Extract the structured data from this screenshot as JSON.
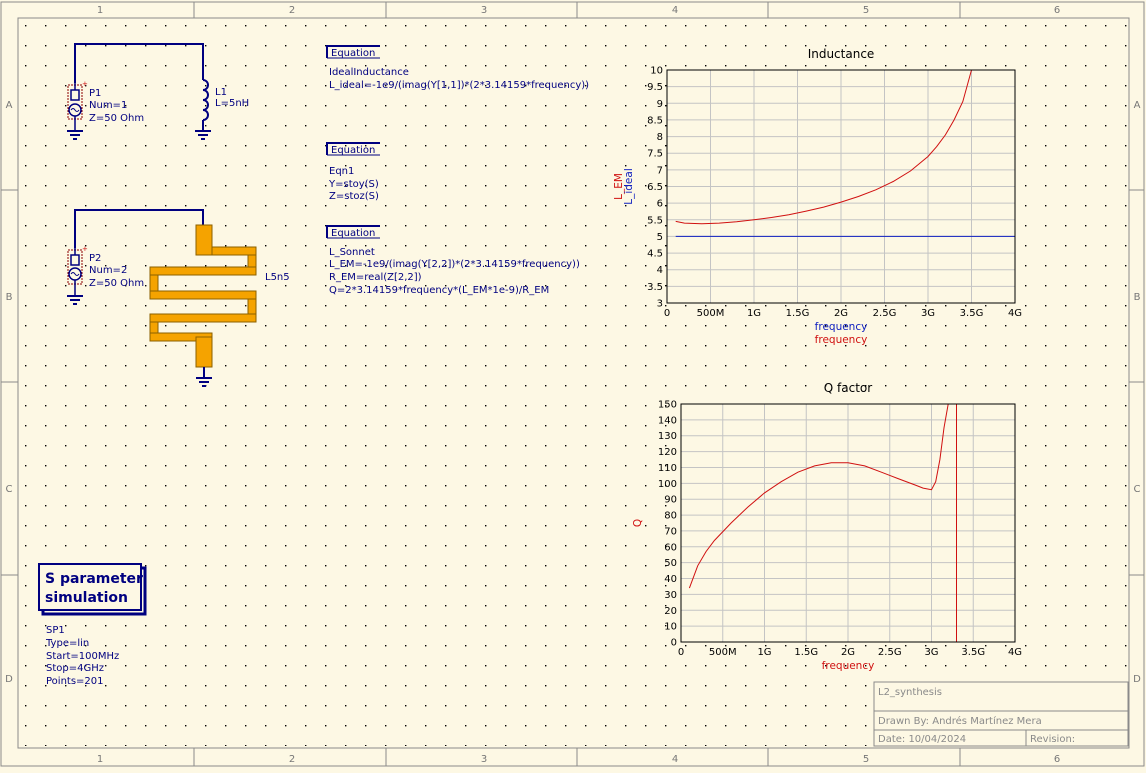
{
  "frame": {
    "cols": [
      "1",
      "2",
      "3",
      "4",
      "5",
      "6"
    ],
    "rows": [
      "A",
      "B",
      "C",
      "D"
    ]
  },
  "components": {
    "p1": {
      "name": "P1",
      "num": "Num=1",
      "z": "Z=50 Ohm"
    },
    "l1": {
      "name": "L1",
      "value": "L=5nH"
    },
    "p2": {
      "name": "P2",
      "num": "Num=2",
      "z": "Z=50 Ohm"
    },
    "em": {
      "name": "L5n5"
    }
  },
  "equations": [
    {
      "header": "Equation",
      "lines": [
        "IdealInductance",
        "L_ideal=-1e9/(imag(Y[1,1])*(2*3.14159*frequency))"
      ]
    },
    {
      "header": "Equation",
      "lines": [
        "Eqn1",
        "Y=stoy(S)",
        "Z=stoz(S)"
      ]
    },
    {
      "header": "Equation",
      "lines": [
        "L_Sonnet",
        "L_EM=-1e9/(imag(Y[2,2])*(2*3.14159*frequency))",
        "R_EM=real(Z[2,2])",
        "Q=2*3.14159*frequency*(L_EM*1e-9)/R_EM"
      ]
    }
  ],
  "simulation": {
    "title_line1": "S parameter",
    "title_line2": "simulation",
    "params": [
      "SP1",
      "Type=lin",
      "Start=100MHz",
      "Stop=4GHz",
      "Points=201"
    ]
  },
  "titleblock": {
    "name": "L2_synthesis",
    "drawn_by": "Drawn By: Andrés Martínez Mera",
    "date": "Date: 10/04/2024",
    "revision": "Revision:"
  },
  "chart_data": [
    {
      "type": "line",
      "title": "Inductance",
      "ylabels": [
        {
          "text": "L_EM",
          "color": "#d01010"
        },
        {
          "text": "L_ideal",
          "color": "#1020c0"
        }
      ],
      "xlabels": [
        {
          "text": "frequency",
          "color": "#1020c0"
        },
        {
          "text": "frequency",
          "color": "#d01010"
        }
      ],
      "xlim": [
        0,
        4
      ],
      "ylim": [
        3,
        10
      ],
      "xticks": [
        {
          "v": 0,
          "t": "0"
        },
        {
          "v": 0.5,
          "t": "500M"
        },
        {
          "v": 1,
          "t": "1G"
        },
        {
          "v": 1.5,
          "t": "1.5G"
        },
        {
          "v": 2,
          "t": "2G"
        },
        {
          "v": 2.5,
          "t": "2.5G"
        },
        {
          "v": 3,
          "t": "3G"
        },
        {
          "v": 3.5,
          "t": "3.5G"
        },
        {
          "v": 4,
          "t": "4G"
        }
      ],
      "yticks": [
        {
          "v": 3,
          "t": "3"
        },
        {
          "v": 3.5,
          "t": "3.5"
        },
        {
          "v": 4,
          "t": "4"
        },
        {
          "v": 4.5,
          "t": "4.5"
        },
        {
          "v": 5,
          "t": "5"
        },
        {
          "v": 5.5,
          "t": "5.5"
        },
        {
          "v": 6,
          "t": "6"
        },
        {
          "v": 6.5,
          "t": "6.5"
        },
        {
          "v": 7,
          "t": "7"
        },
        {
          "v": 7.5,
          "t": "7.5"
        },
        {
          "v": 8,
          "t": "8"
        },
        {
          "v": 8.5,
          "t": "8.5"
        },
        {
          "v": 9,
          "t": "9"
        },
        {
          "v": 9.5,
          "t": "9.5"
        },
        {
          "v": 10,
          "t": "10"
        }
      ],
      "grid": true,
      "series": [
        {
          "name": "L_EM",
          "color": "#d01010",
          "x": [
            0.1,
            0.2,
            0.4,
            0.6,
            0.8,
            1.0,
            1.2,
            1.4,
            1.6,
            1.8,
            2.0,
            2.2,
            2.4,
            2.6,
            2.8,
            3.0,
            3.1,
            3.2,
            3.3,
            3.4,
            3.5
          ],
          "y": [
            5.45,
            5.4,
            5.38,
            5.4,
            5.44,
            5.5,
            5.57,
            5.65,
            5.76,
            5.88,
            6.03,
            6.2,
            6.4,
            6.65,
            6.97,
            7.4,
            7.7,
            8.05,
            8.5,
            9.05,
            10.0
          ]
        },
        {
          "name": "L_ideal",
          "color": "#1020c0",
          "x": [
            0.1,
            4.0
          ],
          "y": [
            5.0,
            5.0
          ]
        }
      ]
    },
    {
      "type": "line",
      "title": "Q factor",
      "ylabels": [
        {
          "text": "Q",
          "color": "#d01010"
        }
      ],
      "xlabels": [
        {
          "text": "frequency",
          "color": "#d01010"
        }
      ],
      "xlim": [
        0,
        4
      ],
      "ylim": [
        0,
        150
      ],
      "xticks": [
        {
          "v": 0,
          "t": "0"
        },
        {
          "v": 0.5,
          "t": "500M"
        },
        {
          "v": 1,
          "t": "1G"
        },
        {
          "v": 1.5,
          "t": "1.5G"
        },
        {
          "v": 2,
          "t": "2G"
        },
        {
          "v": 2.5,
          "t": "2.5G"
        },
        {
          "v": 3,
          "t": "3G"
        },
        {
          "v": 3.5,
          "t": "3.5G"
        },
        {
          "v": 4,
          "t": "4G"
        }
      ],
      "yticks": [
        {
          "v": 0,
          "t": "0"
        },
        {
          "v": 10,
          "t": "10"
        },
        {
          "v": 20,
          "t": "20"
        },
        {
          "v": 30,
          "t": "30"
        },
        {
          "v": 40,
          "t": "40"
        },
        {
          "v": 50,
          "t": "50"
        },
        {
          "v": 60,
          "t": "60"
        },
        {
          "v": 70,
          "t": "70"
        },
        {
          "v": 80,
          "t": "80"
        },
        {
          "v": 90,
          "t": "90"
        },
        {
          "v": 100,
          "t": "100"
        },
        {
          "v": 110,
          "t": "110"
        },
        {
          "v": 120,
          "t": "120"
        },
        {
          "v": 130,
          "t": "130"
        },
        {
          "v": 140,
          "t": "140"
        },
        {
          "v": 150,
          "t": "150"
        }
      ],
      "grid": true,
      "series": [
        {
          "name": "Q",
          "color": "#d01010",
          "x": [
            0.1,
            0.2,
            0.3,
            0.4,
            0.6,
            0.8,
            1.0,
            1.2,
            1.4,
            1.6,
            1.8,
            2.0,
            2.2,
            2.4,
            2.6,
            2.8,
            2.9,
            3.0,
            3.05,
            3.1,
            3.15,
            3.2,
            3.3,
            3.3,
            3.35,
            4.0
          ],
          "y": [
            34,
            48,
            57,
            64,
            75,
            85,
            94,
            101,
            107,
            111,
            113,
            113,
            111,
            107,
            103,
            99,
            97,
            96,
            101,
            115,
            135,
            150,
            150,
            0,
            0,
            0
          ]
        }
      ]
    }
  ],
  "colors": {
    "wire": "#000080",
    "schematic_text": "#000080",
    "component": "#8b0000",
    "em_fill": "#f5a300",
    "em_stroke": "#8b6000",
    "background": "#fdf8e4"
  }
}
